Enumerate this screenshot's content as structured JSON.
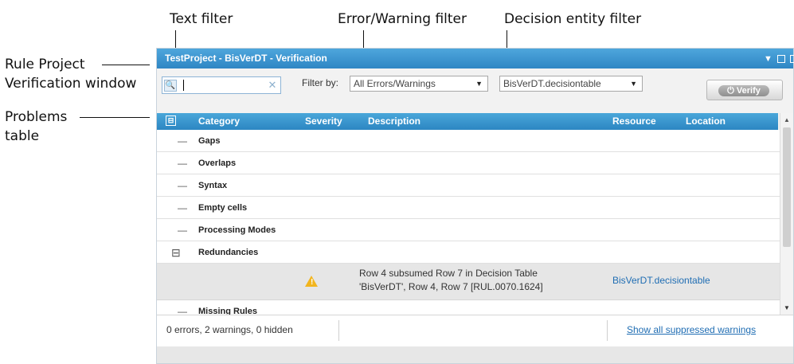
{
  "callouts": {
    "text_filter": "Text filter",
    "error_warning_filter": "Error/Warning filter",
    "decision_entity_filter": "Decision entity filter",
    "rule_project_line1": "Rule Project",
    "rule_project_line2": "Verification window",
    "problems_line1": "Problems",
    "problems_line2": "table"
  },
  "window": {
    "title": "TestProject - BisVerDT - Verification",
    "controls": [
      "▼",
      "▭",
      "▣"
    ]
  },
  "toolbar": {
    "search": {
      "icon": "search-icon",
      "value": "",
      "placeholder": ""
    },
    "filter_by_label": "Filter by:",
    "error_filter": "All Errors/Warnings",
    "entity_filter": "BisVerDT.decisiontable",
    "verify_label": "Verify"
  },
  "table": {
    "columns": [
      "Category",
      "Severity",
      "Description",
      "Resource",
      "Location"
    ],
    "rows": [
      {
        "expander": "—",
        "category": "Gaps"
      },
      {
        "expander": "—",
        "category": "Overlaps"
      },
      {
        "expander": "—",
        "category": "Syntax"
      },
      {
        "expander": "—",
        "category": "Empty cells"
      },
      {
        "expander": "—",
        "category": "Processing Modes"
      },
      {
        "expander": "⊟",
        "category": "Redundancies"
      }
    ],
    "detail": {
      "severity_icon": "warning-icon",
      "description_line1": "Row 4 subsumed Row 7 in Decision Table",
      "description_line2": "'BisVerDT', Row 4, Row 7 [RUL.0070.1624]",
      "resource": "BisVerDT.decisiontable"
    },
    "last_row": {
      "expander": "—",
      "category": "Missing Rules"
    }
  },
  "status": {
    "summary": "0 errors, 2 warnings, 0 hidden",
    "link": "Show all suppressed warnings"
  },
  "colors": {
    "header_blue": "#2f86c4",
    "link_blue": "#1f6db3",
    "warning": "#f2b51e"
  }
}
